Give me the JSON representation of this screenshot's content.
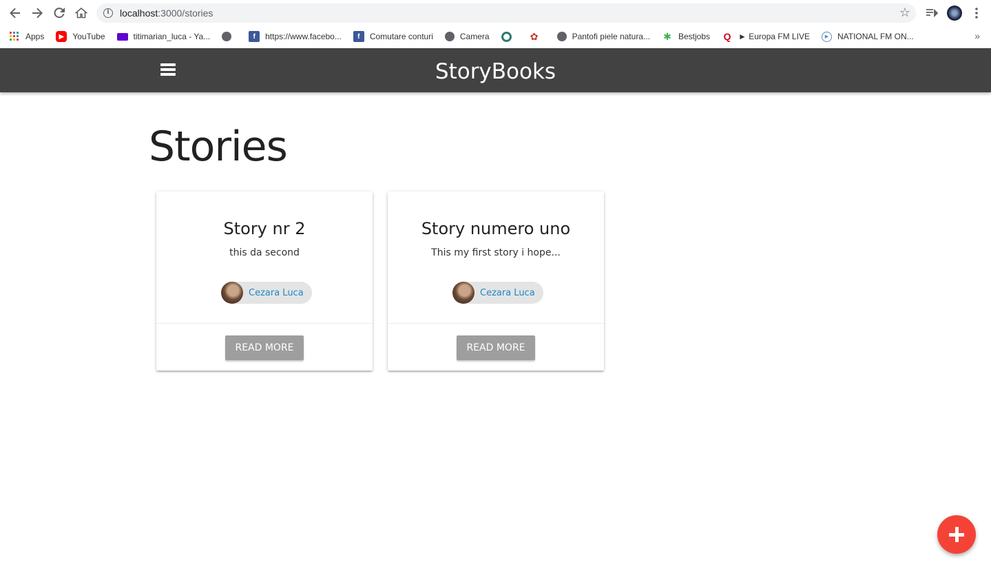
{
  "browser": {
    "url_host": "localhost",
    "url_path": ":3000/stories",
    "bookmarks": [
      {
        "label": "Apps",
        "icon": "apps-grid-icon",
        "color": "#ea4335"
      },
      {
        "label": "YouTube",
        "icon": "youtube-icon",
        "color": "#ff0000"
      },
      {
        "label": "titimarian_luca - Ya...",
        "icon": "yahoo-mail-icon",
        "color": "#6001d2"
      },
      {
        "label": "",
        "icon": "globe-icon",
        "color": "#5f6368"
      },
      {
        "label": "https://www.facebo...",
        "icon": "facebook-icon",
        "color": "#3b5998"
      },
      {
        "label": "Comutare conturi",
        "icon": "facebook-icon",
        "color": "#3b5998"
      },
      {
        "label": "Camera",
        "icon": "globe-icon",
        "color": "#5f6368"
      },
      {
        "label": "",
        "icon": "wikimedia-icon",
        "color": "#2a7a6e"
      },
      {
        "label": "",
        "icon": "flower-icon",
        "color": "#c0392b"
      },
      {
        "label": "Pantofi piele natura...",
        "icon": "globe-icon",
        "color": "#5f6368"
      },
      {
        "label": "Bestjobs",
        "icon": "bestjobs-icon",
        "color": "#3fb24f"
      },
      {
        "label": "► Europa FM LIVE",
        "icon": "europafm-icon",
        "color": "#d0021b"
      },
      {
        "label": "NATIONAL FM ON...",
        "icon": "play-circle-icon",
        "color": "#5b8bb7"
      }
    ]
  },
  "navbar": {
    "brand": "StoryBooks",
    "bg_color": "#424242"
  },
  "main": {
    "title": "Stories",
    "stories": [
      {
        "title": "Story nr 2",
        "body": "this da second",
        "author": "Cezara Luca",
        "action": "READ MORE"
      },
      {
        "title": "Story numero uno",
        "body": "This my first story i hope...",
        "author": "Cezara Luca",
        "action": "READ MORE"
      }
    ]
  },
  "fab": {
    "color": "#f44336",
    "icon": "plus-icon"
  }
}
